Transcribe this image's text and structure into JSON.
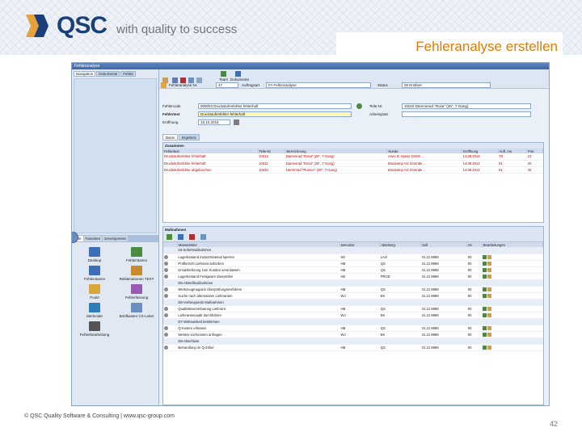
{
  "slide": {
    "logo_text": "QSC",
    "logo_tagline": "with quality to success",
    "title": "Fehleranalyse erstellen",
    "footer": "© QSC Quality Software & Consulting | www.qsc-group.com",
    "page_number": "42"
  },
  "app": {
    "window_title": "Fehleranalyse",
    "left_tabs": [
      "Navigation",
      "Dokumente",
      "Fehler"
    ],
    "left_tabs2": [
      "Alle",
      "Favoriten",
      "Development"
    ],
    "toolbar_labels": {
      "team": "Team",
      "dokumente": "Dokumente"
    },
    "nav_icons": [
      {
        "label": "Desktop",
        "color": "#3d6fb6"
      },
      {
        "label": "Fehlerstamm",
        "color": "#4a8c3c"
      },
      {
        "label": "Fehlerstamm",
        "color": "#3d6fb6"
      },
      {
        "label": "Reklamationen\nTEXT",
        "color": "#c98a2d"
      },
      {
        "label": "Punkt",
        "color": "#d9a63a"
      },
      {
        "label": "Fehlerfassung",
        "color": "#9b59b6"
      },
      {
        "label": "Merkmale",
        "color": "#2c7fb8"
      },
      {
        "label": "Briefkasten CS-Leiter",
        "color": "#6b8fc0"
      },
      {
        "label": "Fehlerbearbeitung",
        "color": "#555555"
      }
    ],
    "form": {
      "fehleranalyse_label": "Fehleranalyse Nr.",
      "fehleranalyse_nr": "47",
      "auftragsart_label": "Auftragsart",
      "auftragsart_value": "FA Fehleranalyse",
      "status_label": "Status",
      "status_value": "00 Erstfeer",
      "fehlercode_label": "Fehlercode",
      "fehlercode_value": "000003 Druckstufenfehler fehlerhaft",
      "fehlertext_label": "Fehlertext",
      "fehlertext_value": "Druckstufenfehler fehlerhaft",
      "eroeffnung_label": "Eröffnung",
      "eroeffnung_value": "15.10.2015",
      "teile_label": "Teile Nr.",
      "teile_value": "10016 Dämmerad \"Rosa\" (26\", 7-Gang)",
      "arbeitsplatz_label": "Arbeitsplatz"
    },
    "tabs": [
      "Basis",
      "Ergebnis"
    ],
    "zusammen": {
      "title": "Zusammen",
      "headers": [
        "Fehlertext",
        "Teile-Nr",
        "Bezeichnung",
        "Kunde",
        "Eröffnung",
        "Auft. ms",
        "Pos"
      ],
      "rows": [
        [
          "Druckstufenfehler fehlerhaft",
          "10013",
          "Damenrad \"Rosa\" (26\", 7-Gang)",
          "Anne B. Huber Gmbh ...",
          "14.08.2014",
          "79",
          "10"
        ],
        [
          "Druckstufenfehler fehlerhaft",
          "10012",
          "Damenrad \"Rosa\" (28\", 7-Gang)",
          "Brackamp AG Zentrale...",
          "14.08.2014",
          "81",
          "20"
        ],
        [
          "Druckstufenfehler abgebrochen",
          "10033",
          "Herrenrad \"Runner\" (28\", 7-Gang)",
          "Brackamp AG Zentrale...",
          "14.08.2014",
          "81",
          "40"
        ]
      ]
    },
    "massnahmen": {
      "title": "Maßnahmen",
      "headers": [
        "Massnahme",
        "Benutzer",
        "Abteilung",
        "Soll",
        "Ist",
        "Bearbeitungen"
      ],
      "rows": [
        {
          "group": true,
          "name": "03-Sofortmaßnahmen"
        },
        {
          "name": "Lagerbestand Zusatzmaterial sperren",
          "user": "SE",
          "dept": "LAG",
          "soll": "31.12.9999",
          "ist": "00"
        },
        {
          "name": "Prüfbericht Lieferant anfordern",
          "user": "HB",
          "dept": "QS",
          "soll": "31.12.9999",
          "ist": "00"
        },
        {
          "name": "Ersatzlieferung zum Kunden veranlassen",
          "user": "HB",
          "dept": "QS",
          "soll": "31.12.9999",
          "ist": "00"
        },
        {
          "name": "Lagerbestand Fertigware überprüfen",
          "user": "HE",
          "dept": "PROD",
          "soll": "31.12.9999",
          "ist": "00"
        },
        {
          "group": true,
          "name": "D5-Abstellmaßnahmen"
        },
        {
          "name": "Werkzeugmagazin Überprüfungsverfahren",
          "user": "HB",
          "dept": "QS",
          "soll": "31.12.9999",
          "ist": "00"
        },
        {
          "name": "Suche nach alternativen Lieferanten",
          "user": "WJ",
          "dept": "EK",
          "soll": "31.12.9999",
          "ist": "00"
        },
        {
          "group": true,
          "name": "D6-Vorbeugende Maßnahmen"
        },
        {
          "name": "Qualitätsvereinbarung Lieferant",
          "user": "HB",
          "dept": "QS",
          "soll": "31.12.9999",
          "ist": "00"
        },
        {
          "name": "Lieferantenaudit durchführen",
          "user": "WJ",
          "dept": "EK",
          "soll": "31.12.9999",
          "ist": "00"
        },
        {
          "group": true,
          "name": "D7-Wirksamkeit bestimmen"
        },
        {
          "name": "Q-Kosten erfassen",
          "user": "HB",
          "dept": "QS",
          "soll": "31.12.9999",
          "ist": "00"
        },
        {
          "name": "Weitere Lieferanten anfragen",
          "user": "WJ",
          "dept": "EK",
          "soll": "31.12.9999",
          "ist": "00"
        },
        {
          "group": true,
          "name": "D8-Abschluss"
        },
        {
          "name": "Behandlung im Q-Zirkel",
          "user": "HB",
          "dept": "QS",
          "soll": "31.12.9999",
          "ist": "00"
        }
      ]
    }
  }
}
